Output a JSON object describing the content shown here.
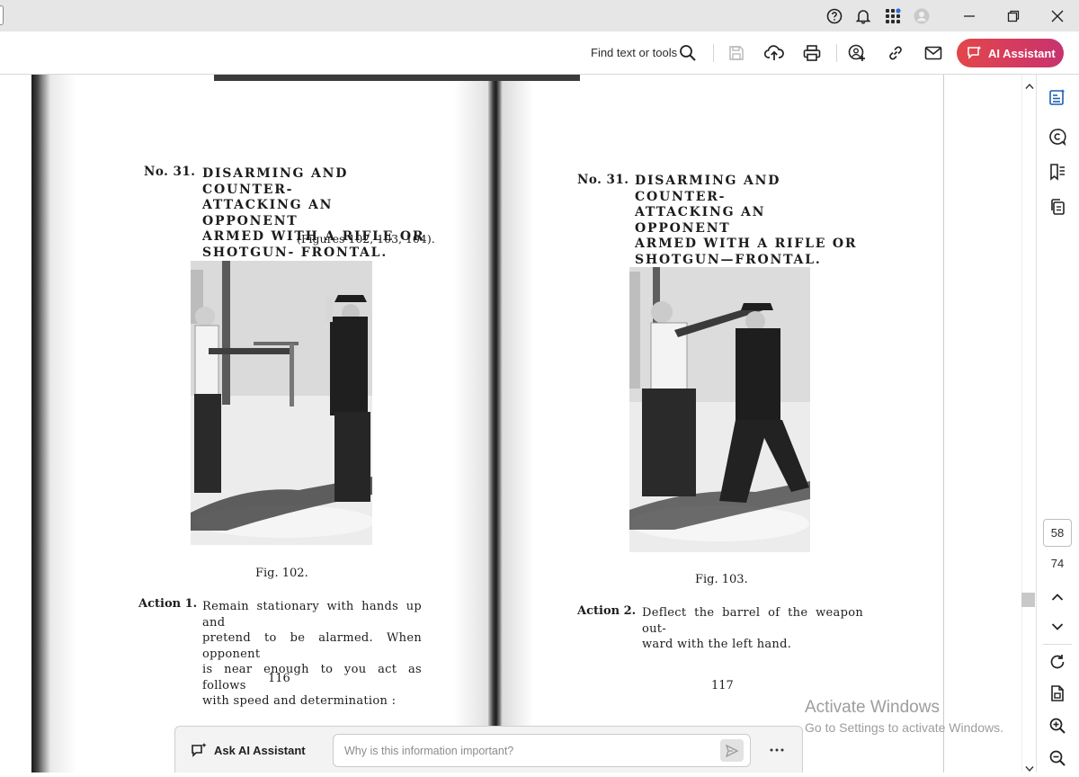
{
  "toolbar": {
    "find_label": "Find text or tools",
    "ai_button_label": "AI Assistant"
  },
  "document": {
    "left_page": {
      "number_label": "No. 31.",
      "heading_lines": [
        "DISARMING AND COUNTER-",
        "ATTACKING AN OPPONENT",
        "ARMED WITH A RIFLE OR",
        "SHOTGUN- FRONTAL."
      ],
      "figures_ref": "(Figures 102, 103, 104).",
      "fig_caption": "Fig. 102.",
      "action_label": "Action 1.",
      "action_lines": [
        "Remain stationary with hands up and",
        "pretend to be alarmed. When opponent",
        "is near enough to you act as follows",
        "with speed and determination :"
      ],
      "page_number": "116"
    },
    "right_page": {
      "number_label": "No. 31.",
      "heading_lines": [
        "DISARMING AND COUNTER-",
        "ATTACKING AN OPPONENT",
        "ARMED WITH A RIFLE OR",
        "SHOTGUN—FRONTAL."
      ],
      "fig_caption": "Fig. 103.",
      "action_label": "Action 2.",
      "action_lines": [
        "Deflect the barrel of the weapon out-",
        "ward with the left hand."
      ],
      "page_number": "117"
    }
  },
  "navigation": {
    "current_page": "58",
    "total_pages": "74"
  },
  "watermark": {
    "line1": "Activate Windows",
    "line2": "Go to Settings to activate Windows."
  },
  "ask_ai": {
    "label": "Ask AI Assistant",
    "placeholder": "Why is this information important?"
  },
  "colors": {
    "ai_gradient_start": "#e3474a",
    "ai_gradient_end": "#c8326f",
    "rail_icon_blue": "#1a5fb4"
  }
}
